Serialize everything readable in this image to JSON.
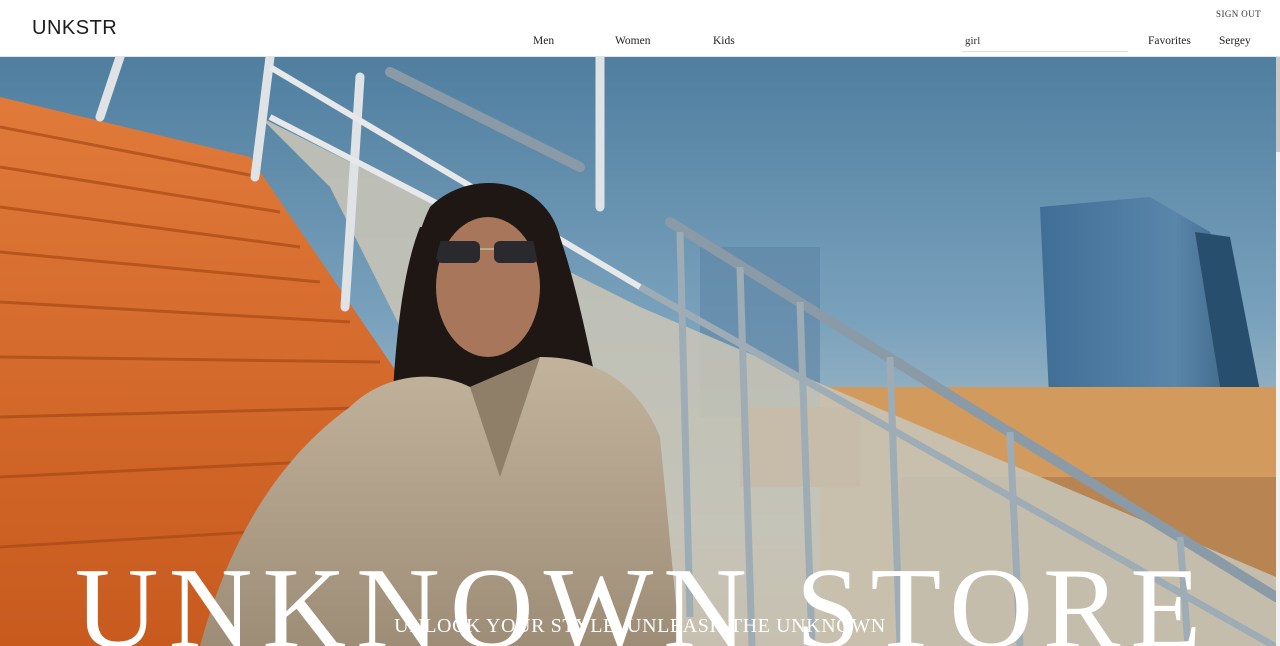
{
  "brand": {
    "logo": "UNKSTR"
  },
  "header": {
    "signout_label": "SIGN OUT",
    "nav": {
      "men": "Men",
      "women": "Women",
      "kids": "Kids"
    },
    "search": {
      "value": "girl",
      "placeholder": ""
    },
    "favorites_label": "Favorites",
    "user_label": "Sergey"
  },
  "hero": {
    "title": "UNKNOWN STORE",
    "tagline": "UNLOCK YOUR STYLE, UNLEASH THE UNKNOWN",
    "image": "woman-in-sunglasses-on-orange-stairs-photo"
  },
  "colors": {
    "header_bg": "#ffffff",
    "text": "#222222",
    "hero_text": "#ffffff",
    "stairs": "#d9692a",
    "sky": "#6a93b0"
  }
}
